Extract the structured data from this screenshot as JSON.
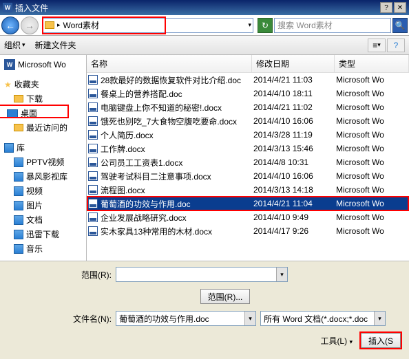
{
  "window": {
    "title": "插入文件",
    "icon_text": "W"
  },
  "nav": {
    "path": "Word素材",
    "search_placeholder": "搜索 Word素材"
  },
  "toolbar": {
    "organize": "组织",
    "new_folder": "新建文件夹"
  },
  "sidebar": {
    "recent_doc": "Microsoft Wo",
    "favorites": {
      "label": "收藏夹",
      "items": [
        "下载",
        "桌面",
        "最近访问的"
      ]
    },
    "libraries": {
      "label": "库",
      "items": [
        "PPTV视频",
        "暴风影视库",
        "视频",
        "图片",
        "文档",
        "迅雷下载",
        "音乐"
      ]
    }
  },
  "columns": {
    "name": "名称",
    "date": "修改日期",
    "type": "类型"
  },
  "files": [
    {
      "name": "28款最好的数据恢复软件对比介绍.doc",
      "date": "2014/4/21 11:03",
      "type": "Microsoft Wo"
    },
    {
      "name": "餐桌上的营养搭配.doc",
      "date": "2014/4/10 18:11",
      "type": "Microsoft Wo"
    },
    {
      "name": "电脑键盘上你不知道的秘密!.docx",
      "date": "2014/4/21 11:02",
      "type": "Microsoft Wo"
    },
    {
      "name": "饿死也别吃_7大食物空腹吃要命.docx",
      "date": "2014/4/10 16:06",
      "type": "Microsoft Wo"
    },
    {
      "name": "个人简历.docx",
      "date": "2014/3/28 11:19",
      "type": "Microsoft Wo"
    },
    {
      "name": "工作牌.docx",
      "date": "2014/3/13 15:46",
      "type": "Microsoft Wo"
    },
    {
      "name": "公司员工工资表1.docx",
      "date": "2014/4/8 10:31",
      "type": "Microsoft Wo"
    },
    {
      "name": "驾驶考试科目二注意事项.docx",
      "date": "2014/4/10 16:06",
      "type": "Microsoft Wo"
    },
    {
      "name": "流程图.docx",
      "date": "2014/3/13 14:18",
      "type": "Microsoft Wo"
    },
    {
      "name": "葡萄酒的功效与作用.doc",
      "date": "2014/4/21 11:04",
      "type": "Microsoft Wo",
      "selected": true
    },
    {
      "name": "企业发展战略研究.docx",
      "date": "2014/4/10 9:49",
      "type": "Microsoft Wo"
    },
    {
      "name": "实木家具13种常用的木材.docx",
      "date": "2014/4/17 9:26",
      "type": "Microsoft Wo"
    }
  ],
  "bottom": {
    "range_label": "范围(R):",
    "range_button": "范围(R)...",
    "filename_label": "文件名(N):",
    "filename_value": "葡萄酒的功效与作用.doc",
    "filetype_value": "所有 Word 文档(*.docx;*.doc",
    "tools_label": "工具(L)",
    "insert_label": "插入(S"
  }
}
